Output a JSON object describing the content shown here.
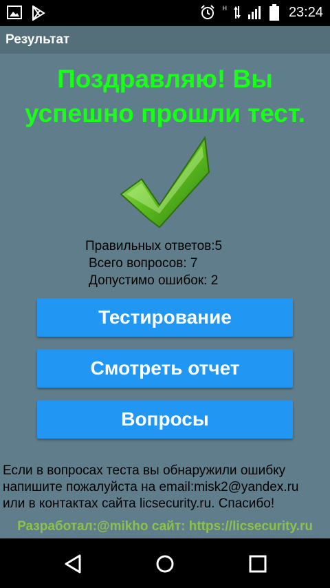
{
  "status_bar": {
    "time": "23:24",
    "network_type": "H",
    "icons": [
      "image-icon",
      "play-store-icon",
      "alarm-icon",
      "data-arrows-icon",
      "signal-icon",
      "battery-icon"
    ]
  },
  "title_bar": {
    "title": "Результат"
  },
  "main": {
    "headline_line1": "Поздравляю! Вы",
    "headline_line2": "успешно прошли тест.",
    "check_icon": "checkmark-icon",
    "stats": {
      "correct": "Правильных ответов:5",
      "total": "Всего вопросов: 7",
      "allowed_errors": "Допустимо ошибок: 2"
    },
    "buttons": {
      "testing": "Тестирование",
      "report": "Смотреть отчет",
      "questions": "Вопросы"
    },
    "info_text_line1": "Если в вопросах теста вы обнаружили ошибку",
    "info_text_line2": "напишите пожалуйста на email:misk2@yandex.ru",
    "info_text_line3": "или в контактах сайта licsecurity.ru. Спасибо!",
    "developer_text": "Разработал:@mikho сайт: https://licsecurity.ru"
  },
  "nav_bar": {
    "icons": [
      "back-icon",
      "home-icon",
      "recents-icon"
    ]
  },
  "colors": {
    "background": "#607d8b",
    "title_bar": "#546e7a",
    "headline": "#1aff1a",
    "button": "#2196f3",
    "developer_text": "#8bc34a"
  }
}
